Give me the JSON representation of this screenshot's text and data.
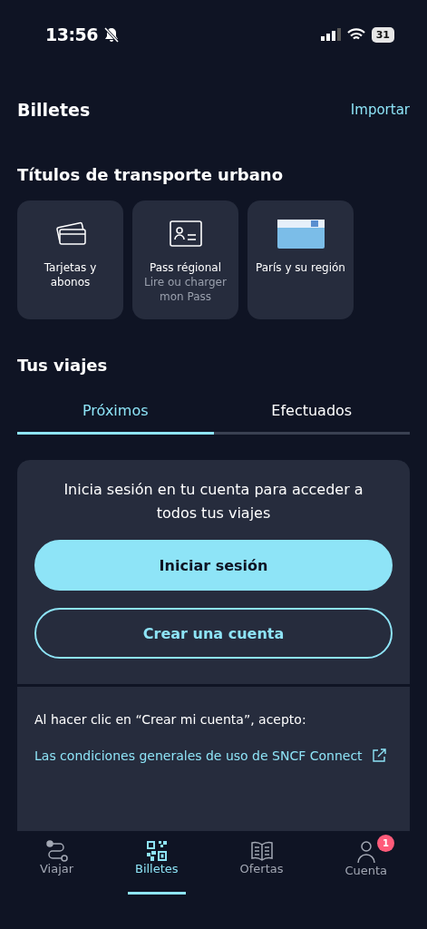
{
  "status_bar": {
    "time": "13:56",
    "battery": "31"
  },
  "header": {
    "title": "Billetes",
    "action": "Importar"
  },
  "urban_section": {
    "title": "Títulos de transporte urbano",
    "tiles": [
      {
        "kind": "cards",
        "title": "Tarjetas y abonos"
      },
      {
        "kind": "pass",
        "title": "Pass régional",
        "subtitle": "Lire ou charger mon Pass"
      },
      {
        "kind": "navigo",
        "title": "París y su región"
      }
    ]
  },
  "trips": {
    "title": "Tus viajes",
    "tabs": [
      {
        "label": "Próximos",
        "selected": true
      },
      {
        "label": "Efectuados",
        "selected": false
      }
    ]
  },
  "login_card": {
    "message": "Inicia sesión en tu cuenta para acceder a todos tus viajes",
    "primary_button": "Iniciar sesión",
    "secondary_button": "Crear una cuenta",
    "terms_intro": "Al hacer clic en “Crear mi cuenta”, acepto:",
    "terms_link": "Las condiciones generales de uso de SNCF Connect"
  },
  "bottom_nav": [
    {
      "kind": "route",
      "label": "Viajar",
      "selected": false
    },
    {
      "kind": "qr",
      "label": "Billetes",
      "selected": true
    },
    {
      "kind": "book",
      "label": "Ofertas",
      "selected": false
    },
    {
      "kind": "user",
      "label": "Cuenta",
      "selected": false,
      "badge": "1"
    }
  ]
}
